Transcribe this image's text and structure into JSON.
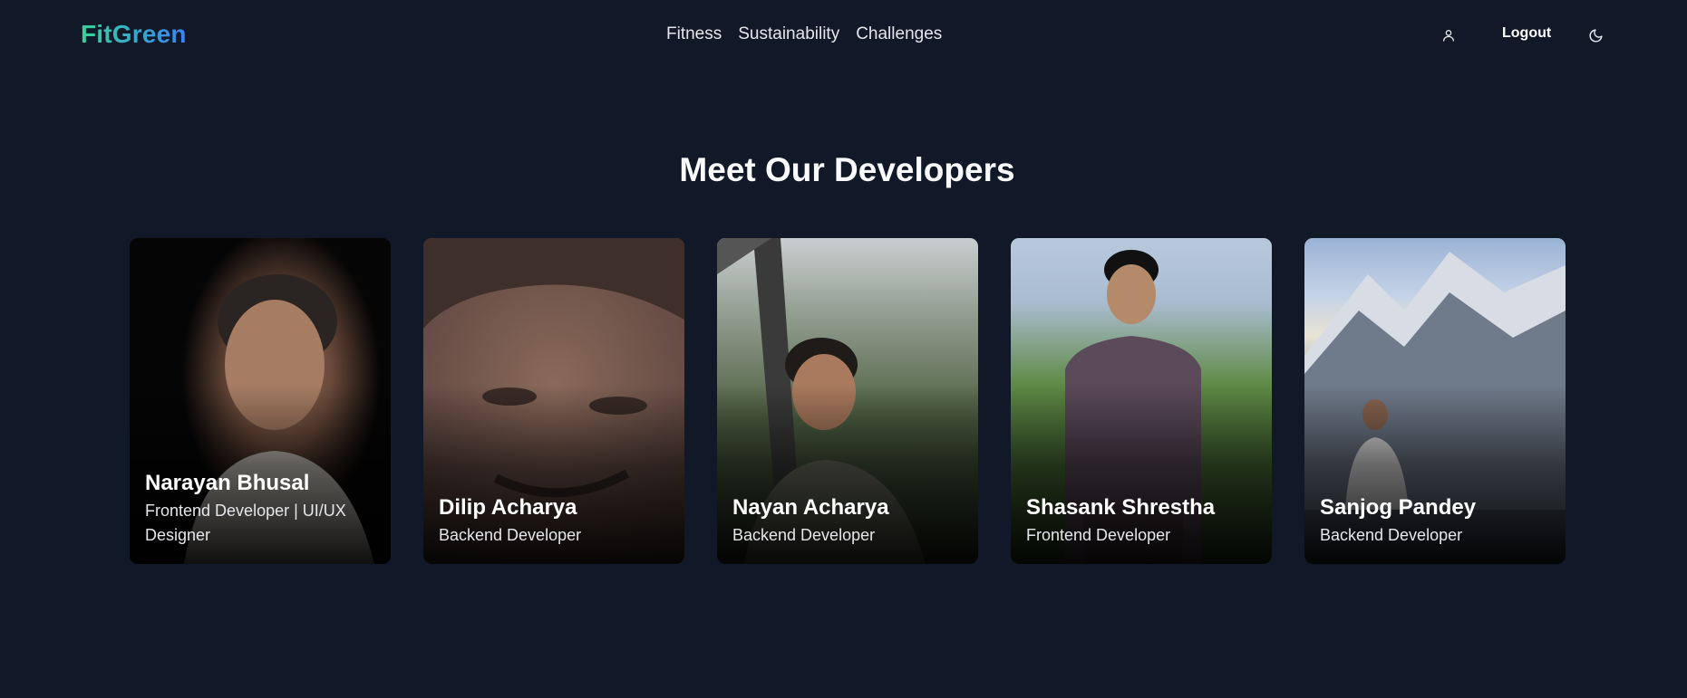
{
  "header": {
    "brand": "FitGreen",
    "nav": [
      {
        "label": "Fitness"
      },
      {
        "label": "Sustainability"
      },
      {
        "label": "Challenges"
      }
    ],
    "user_icon": "user-icon",
    "logout_label": "Logout",
    "theme_icon": "moon-icon"
  },
  "section": {
    "title": "Meet Our Developers"
  },
  "developers": [
    {
      "name": "Narayan Bhusal",
      "role": "Frontend Developer | UI/UX Designer",
      "photo": "portrait-dark-background"
    },
    {
      "name": "Dilip Acharya",
      "role": "Backend Developer",
      "photo": "closeup-portrait"
    },
    {
      "name": "Nayan Acharya",
      "role": "Backend Developer",
      "photo": "portrait-cable-car-mountains"
    },
    {
      "name": "Shasank Shrestha",
      "role": "Frontend Developer",
      "photo": "portrait-outdoors-greenery"
    },
    {
      "name": "Sanjog Pandey",
      "role": "Backend Developer",
      "photo": "portrait-snowy-mountains"
    }
  ],
  "colors": {
    "background": "#111827",
    "brand_gradient_start": "#34d399",
    "brand_gradient_end": "#3b82f6",
    "text": "#ffffff"
  }
}
